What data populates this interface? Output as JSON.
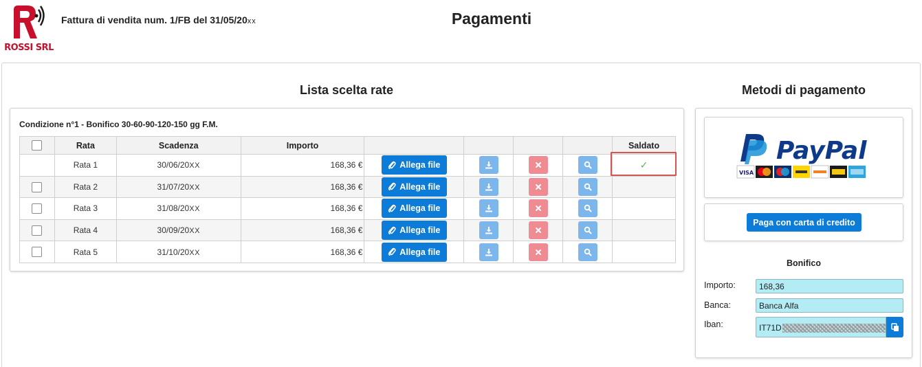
{
  "header": {
    "company": "ROSSI SRL",
    "document_title": "Fattura di vendita num. 1/FB del 31/05/20",
    "document_title_suffix": "xx",
    "page_title": "Pagamenti"
  },
  "rates_section": {
    "title": "Lista scelta rate",
    "condition": "Condizione n°1 - Bonifico 30-60-90-120-150 gg F.M.",
    "columns": [
      "",
      "Rata",
      "Scadenza",
      "Importo",
      "",
      "",
      "",
      "",
      "Saldato"
    ],
    "rows": [
      {
        "rata": "Rata 1",
        "scadenza": "30/06/20",
        "scadenza_suffix": "XX",
        "importo": "168,36 €",
        "attach_label": "Allega file",
        "saldato": "✓"
      },
      {
        "rata": "Rata 2",
        "scadenza": "31/07/20",
        "scadenza_suffix": "XX",
        "importo": "168,36 €",
        "attach_label": "Allega file",
        "saldato": ""
      },
      {
        "rata": "Rata 3",
        "scadenza": "31/08/20",
        "scadenza_suffix": "XX",
        "importo": "168,36 €",
        "attach_label": "Allega file",
        "saldato": ""
      },
      {
        "rata": "Rata 4",
        "scadenza": "30/09/20",
        "scadenza_suffix": "XX",
        "importo": "168,36 €",
        "attach_label": "Allega file",
        "saldato": ""
      },
      {
        "rata": "Rata 5",
        "scadenza": "31/10/20",
        "scadenza_suffix": "XX",
        "importo": "168,36 €",
        "attach_label": "Allega file",
        "saldato": ""
      }
    ]
  },
  "methods_section": {
    "title": "Metodi di pagamento",
    "paypal_logo": "PayPal",
    "card_button": "Paga con carta di credito",
    "bonifico": {
      "title": "Bonifico",
      "importo_label": "Importo:",
      "importo_value": "168,36",
      "banca_label": "Banca:",
      "banca_value": "Banca Alfa",
      "iban_label": "Iban:",
      "iban_value": "IT71D"
    }
  },
  "colors": {
    "primary_button": "#0d7bd8",
    "light_button": "#7db6ea",
    "delete_button": "#ee8b93",
    "success_check": "#5cb85c",
    "highlight_border": "#d9534f",
    "field_background": "#b3ecf5",
    "logo_red": "#c8102e"
  }
}
